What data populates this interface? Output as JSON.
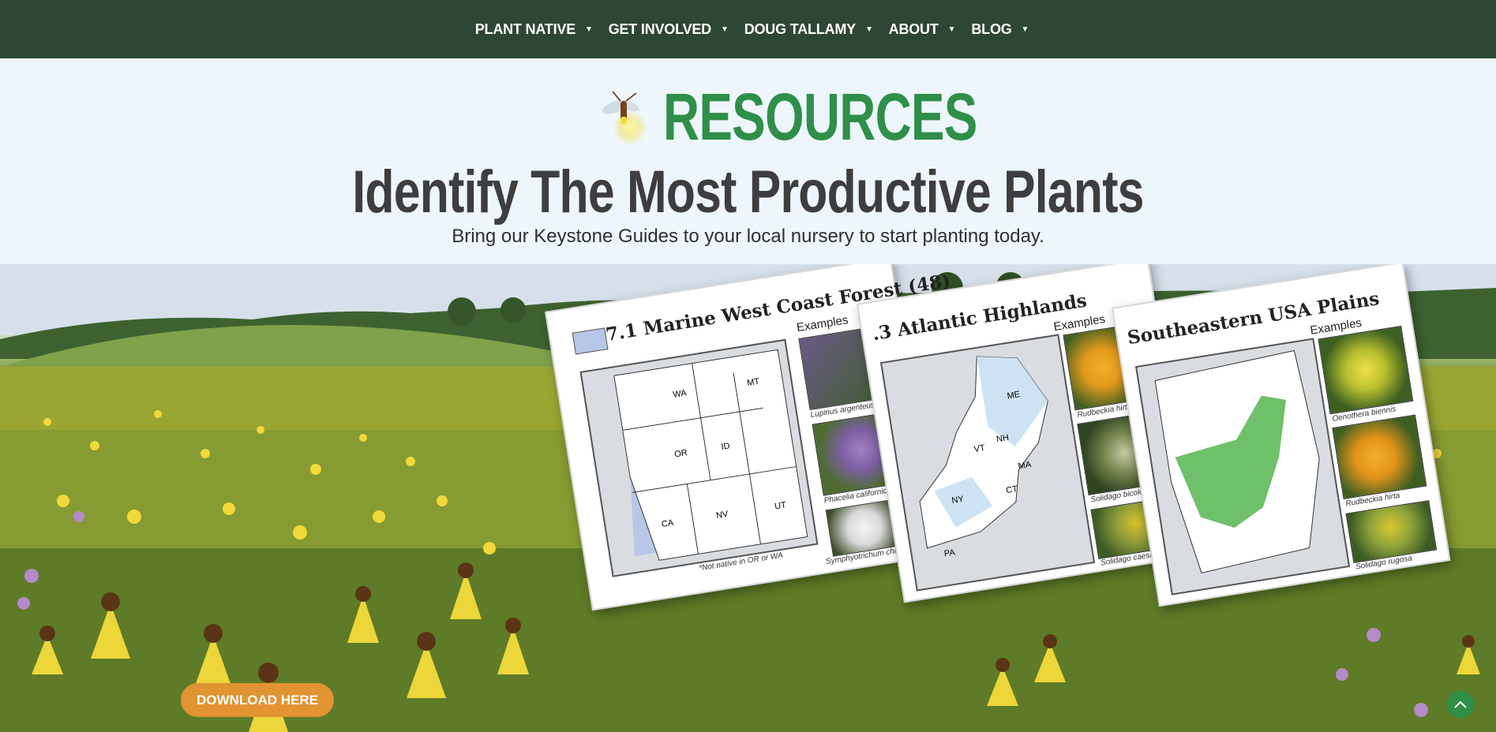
{
  "nav": {
    "items": [
      {
        "label": "PLANT NATIVE"
      },
      {
        "label": "GET INVOLVED"
      },
      {
        "label": "DOUG TALLAMY"
      },
      {
        "label": "ABOUT"
      },
      {
        "label": "BLOG"
      }
    ],
    "caret": "▼"
  },
  "hero": {
    "section_label": "RESOURCES",
    "headline": "Identify The Most Productive Plants",
    "subline": "Bring our Keystone Guides to your local nursery to start planting today."
  },
  "cards": [
    {
      "title": "7.1 Marine West Coast Forest (48)",
      "examples_label": "Examples",
      "captions": [
        "Lupinus argenteus",
        "Phacelia californica*",
        "Symphyotrichum chilense"
      ],
      "note": "*Not native in OR or WA",
      "states": [
        "WA",
        "MT",
        "OR",
        "ID",
        "CA",
        "NV",
        "UT"
      ]
    },
    {
      "title": ".3 Atlantic Highlands",
      "examples_label": "Examples",
      "captions": [
        "Rudbeckia hirta",
        "Solidago bicolor",
        "Solidago caesia"
      ],
      "states": [
        "ME",
        "VT",
        "NH",
        "MA",
        "NY",
        "CT",
        "PA"
      ]
    },
    {
      "title": "Southeastern USA Plains",
      "examples_label": "Examples",
      "captions": [
        "Oenothera biennis",
        "Rudbeckia hirta",
        "Solidago rugosa"
      ]
    }
  ],
  "cta": {
    "download_label": "DOWNLOAD HERE"
  },
  "colors": {
    "nav_bg": "#2e4734",
    "accent_green": "#2f8f48",
    "headline": "#3e3d40",
    "button_orange": "#e29332",
    "hero_bg": "#eef6fd"
  },
  "icons": {
    "firefly": "firefly-icon",
    "scroll_top": "chevron-up-icon"
  }
}
